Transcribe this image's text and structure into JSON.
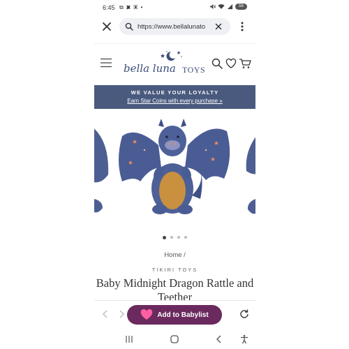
{
  "status_bar": {
    "time": "6:45",
    "notification_icons": "⧉ ✖ ▣ •",
    "battery": "58"
  },
  "browser": {
    "url": "https://www.bellalunato",
    "icons": [
      "close-icon",
      "search-icon",
      "clear-icon",
      "more-vert-icon"
    ]
  },
  "site": {
    "logo_script": "bella luna",
    "logo_toys": "TOYS",
    "icons": [
      "hamburger-icon",
      "search-icon",
      "heart-icon",
      "cart-icon"
    ]
  },
  "banner": {
    "title": "WE VALUE YOUR LOYALTY",
    "link": "Earn Star Coins with every purchase »",
    "background": "#4a5a7f"
  },
  "carousel": {
    "slide_count": 4,
    "active_index": 0,
    "image": "dragon-plush-image"
  },
  "product": {
    "breadcrumb": "Home /",
    "vendor": "TIKIRI TOYS",
    "title": "Baby Midnight Dragon Rattle and Teether"
  },
  "bottom_bar": {
    "add_button": "Add to Babylist",
    "button_color": "#6b2a5d",
    "icons": [
      "back-arrow-icon",
      "forward-arrow-icon",
      "heart-icon",
      "refresh-icon"
    ]
  },
  "android_nav": {
    "icons": [
      "recents-icon",
      "home-icon",
      "back-icon",
      "accessibility-icon"
    ]
  }
}
